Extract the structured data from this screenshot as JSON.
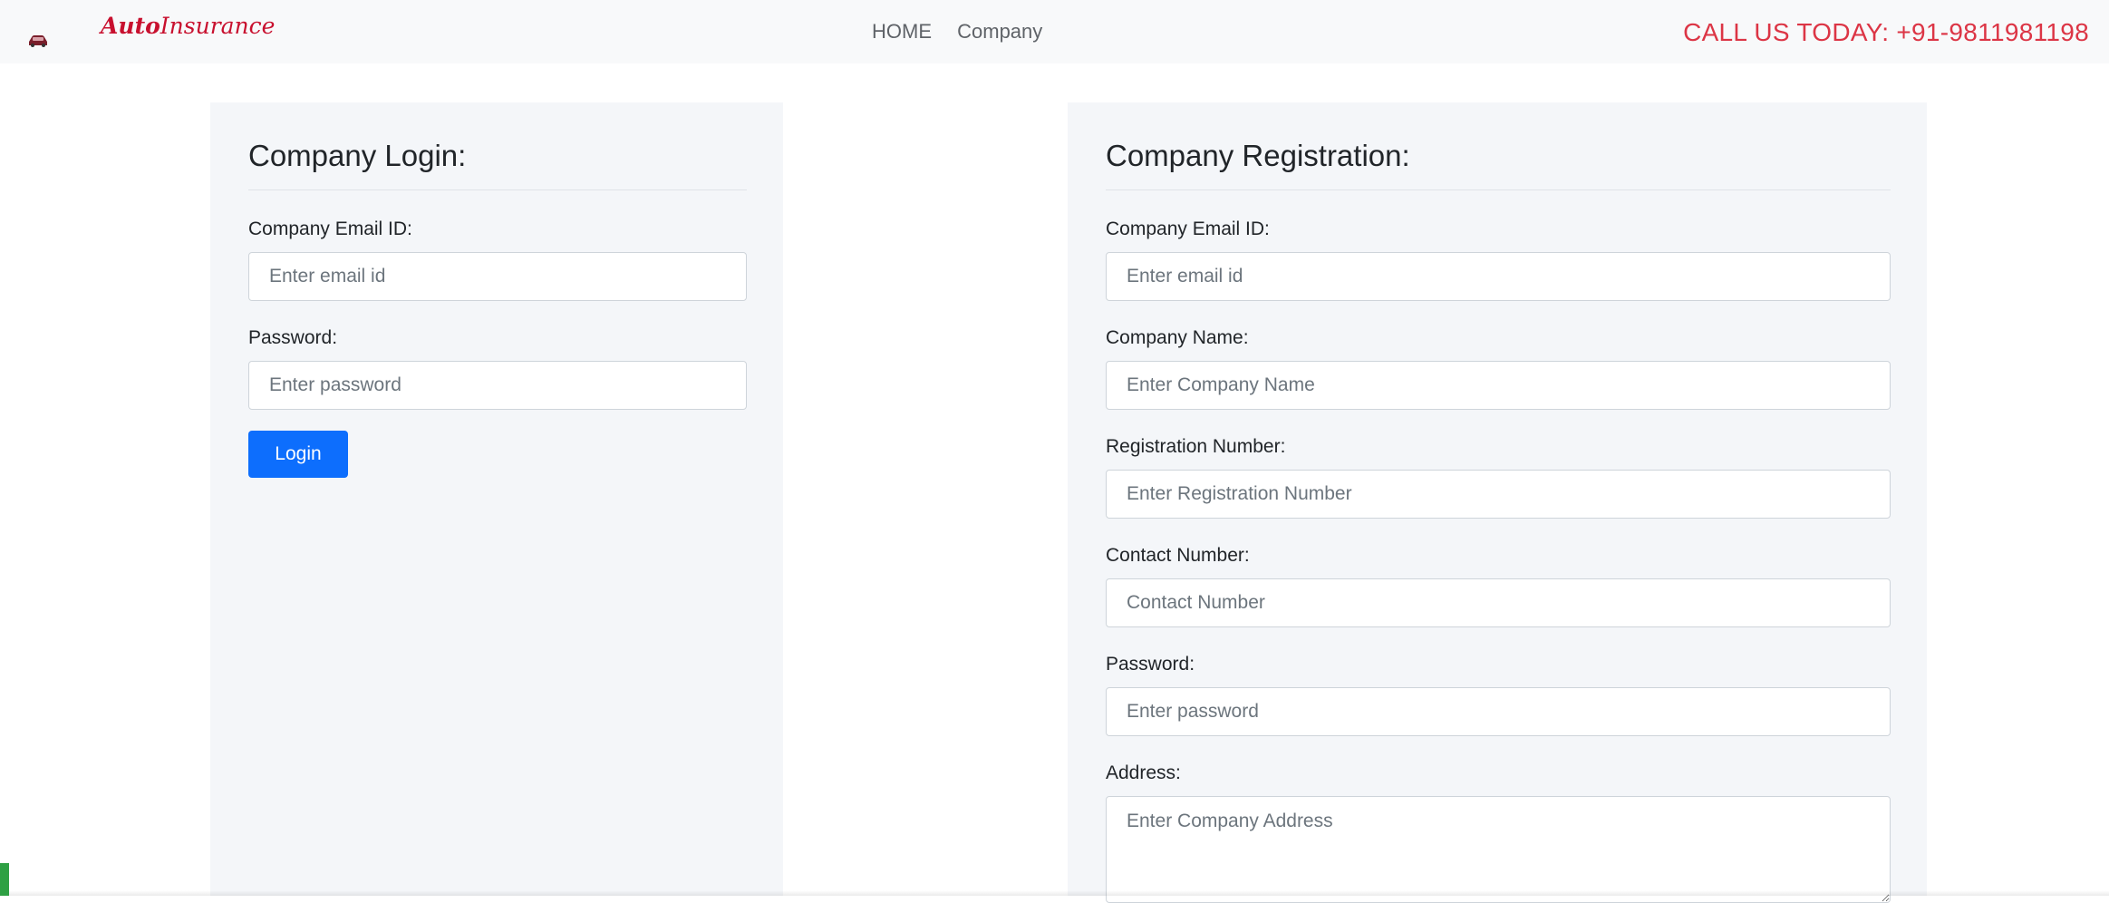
{
  "navbar": {
    "brand_part1": "Auto",
    "brand_part2": "Insurance",
    "links": [
      "HOME",
      "Company"
    ],
    "call_us": "CALL US TODAY: +91-9811981198",
    "accent_color": "#dc3545",
    "brand_icon": "car-icon"
  },
  "login": {
    "title": "Company Login:",
    "email_label": "Company Email ID:",
    "email_placeholder": "Enter email id",
    "password_label": "Password:",
    "password_placeholder": "Enter password",
    "button_label": "Login",
    "button_color": "#0d6efd"
  },
  "registration": {
    "title": "Company Registration:",
    "email_label": "Company Email ID:",
    "email_placeholder": "Enter email id",
    "name_label": "Company Name:",
    "name_placeholder": "Enter Company Name",
    "regno_label": "Registration Number:",
    "regno_placeholder": "Enter Registration Number",
    "contact_label": "Contact Number:",
    "contact_placeholder": "Contact Number",
    "password_label": "Password:",
    "password_placeholder": "Enter password",
    "address_label": "Address:",
    "address_placeholder": "Enter Company Address"
  }
}
